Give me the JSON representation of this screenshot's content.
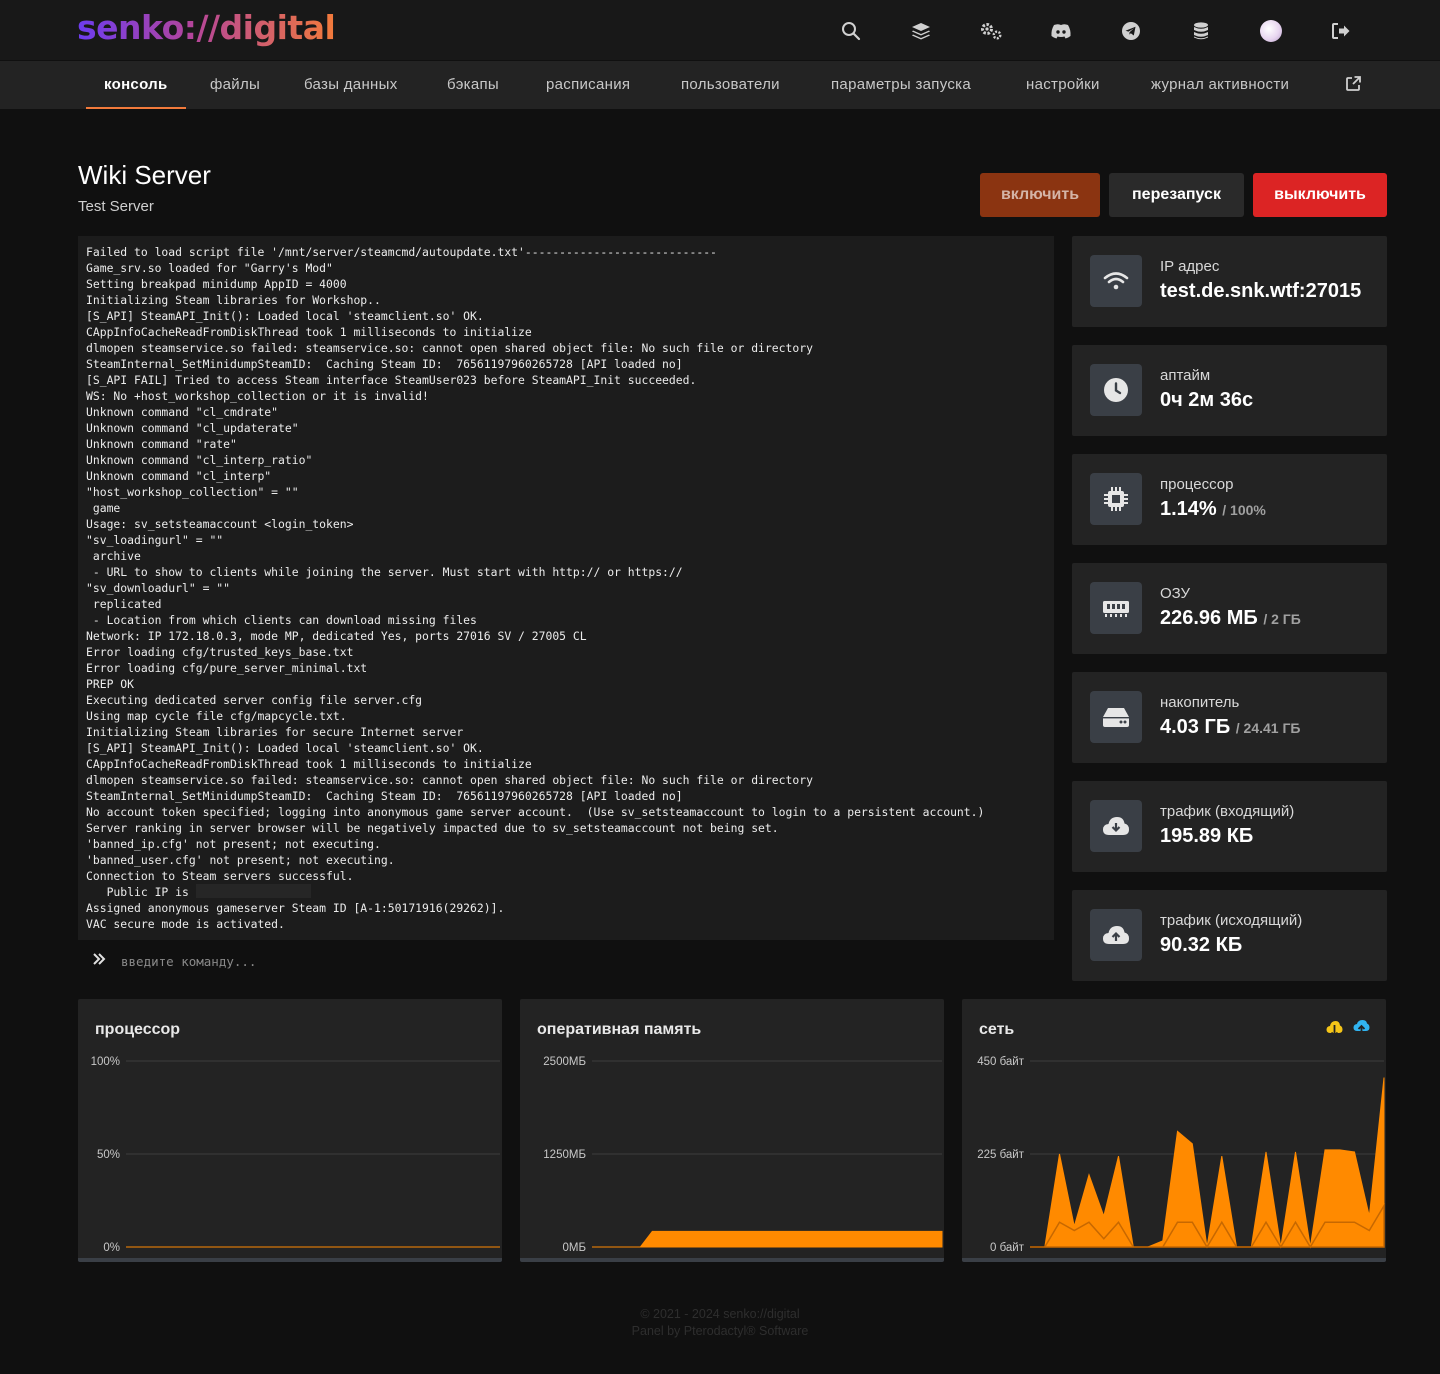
{
  "brand": {
    "logo": "senko://digital"
  },
  "header_icons": [
    "search-icon",
    "layers-icon",
    "cogs-icon",
    "discord-icon",
    "telegram-icon",
    "database-icon",
    "avatar",
    "logout-icon"
  ],
  "tabs": [
    {
      "label": "консоль",
      "active": true
    },
    {
      "label": "файлы"
    },
    {
      "label": "базы данных"
    },
    {
      "label": "бэкапы"
    },
    {
      "label": "расписания"
    },
    {
      "label": "пользователи"
    },
    {
      "label": "параметры запуска"
    },
    {
      "label": "настройки"
    },
    {
      "label": "журнал активности"
    }
  ],
  "server": {
    "name": "Wiki Server",
    "description": "Test Server"
  },
  "power": {
    "start": "включить",
    "restart": "перезапуск",
    "stop": "выключить"
  },
  "console": {
    "lines": [
      "Failed to load script file '/mnt/server/steamcmd/autoupdate.txt'----------------------------",
      "Game_srv.so loaded for \"Garry's Mod\"",
      "Setting breakpad minidump AppID = 4000",
      "Initializing Steam libraries for Workshop..",
      "[S_API] SteamAPI_Init(): Loaded local 'steamclient.so' OK.",
      "CAppInfoCacheReadFromDiskThread took 1 milliseconds to initialize",
      "dlmopen steamservice.so failed: steamservice.so: cannot open shared object file: No such file or directory",
      "SteamInternal_SetMinidumpSteamID:  Caching Steam ID:  76561197960265728 [API loaded no]",
      "[S_API FAIL] Tried to access Steam interface SteamUser023 before SteamAPI_Init succeeded.",
      "WS: No +host_workshop_collection or it is invalid!",
      "Unknown command \"cl_cmdrate\"",
      "Unknown command \"cl_updaterate\"",
      "Unknown command \"rate\"",
      "Unknown command \"cl_interp_ratio\"",
      "Unknown command \"cl_interp\"",
      "\"host_workshop_collection\" = \"\"",
      " game",
      "Usage: sv_setsteamaccount <login_token>",
      "\"sv_loadingurl\" = \"\"",
      " archive",
      " - URL to show to clients while joining the server. Must start with http:// or https://",
      "\"sv_downloadurl\" = \"\"",
      " replicated",
      " - Location from which clients can download missing files",
      "Network: IP 172.18.0.3, mode MP, dedicated Yes, ports 27016 SV / 27005 CL",
      "Error loading cfg/trusted_keys_base.txt",
      "Error loading cfg/pure_server_minimal.txt",
      "PREP OK",
      "Executing dedicated server config file server.cfg",
      "Using map cycle file cfg/mapcycle.txt.",
      "Initializing Steam libraries for secure Internet server",
      "[S_API] SteamAPI_Init(): Loaded local 'steamclient.so' OK.",
      "CAppInfoCacheReadFromDiskThread took 1 milliseconds to initialize",
      "dlmopen steamservice.so failed: steamservice.so: cannot open shared object file: No such file or directory",
      "SteamInternal_SetMinidumpSteamID:  Caching Steam ID:  76561197960265728 [API loaded no]",
      "No account token specified; logging into anonymous game server account.  (Use sv_setsteamaccount to login to a persistent account.)",
      "Server ranking in server browser will be negatively impacted due to sv_setsteamaccount not being set.",
      "'banned_ip.cfg' not present; not executing.",
      "'banned_user.cfg' not present; not executing.",
      "Connection to Steam servers successful.",
      "   Public IP is ",
      "Assigned anonymous gameserver Steam ID [A-1:50171916(29262)].",
      "VAC secure mode is activated."
    ],
    "masked_line_index": 40,
    "input_placeholder": "введите команду..."
  },
  "stats": [
    {
      "icon": "wifi-icon",
      "label": "IP адрес",
      "value": "test.de.snk.wtf:27015",
      "max": ""
    },
    {
      "icon": "clock-icon",
      "label": "аптайм",
      "value": "0ч 2м 36с",
      "max": ""
    },
    {
      "icon": "cpu-icon",
      "label": "процессор",
      "value": "1.14%",
      "max": "/ 100%"
    },
    {
      "icon": "memory-icon",
      "label": "ОЗУ",
      "value": "226.96 МБ",
      "max": "/ 2 ГБ"
    },
    {
      "icon": "hdd-icon",
      "label": "накопитель",
      "value": "4.03 ГБ",
      "max": "/ 24.41 ГБ"
    },
    {
      "icon": "cloud-download-icon",
      "label": "трафик (входящий)",
      "value": "195.89 КБ",
      "max": ""
    },
    {
      "icon": "cloud-upload-icon",
      "label": "трафик (исходящий)",
      "value": "90.32 КБ",
      "max": ""
    }
  ],
  "charts_meta": {
    "accent": "#ff8a00",
    "legend_in": "#f5c518",
    "legend_out": "#31b4f0"
  },
  "chart_data": [
    {
      "type": "area",
      "title": "процессор",
      "yticks": [
        "100%",
        "50%",
        "0%"
      ],
      "ylim": [
        0,
        100
      ],
      "values": [
        0,
        0,
        0,
        0,
        0,
        0,
        0,
        0,
        0,
        0,
        0,
        0,
        0,
        0,
        0,
        0,
        0,
        0,
        0,
        0,
        0,
        0,
        0,
        0,
        0,
        0,
        0,
        0,
        0,
        0
      ]
    },
    {
      "type": "area",
      "title": "оперативная память",
      "yticks": [
        "2500МБ",
        "1250МБ",
        "0МБ"
      ],
      "ylim": [
        0,
        2500
      ],
      "values": [
        0,
        0,
        0,
        0,
        0,
        210,
        210,
        210,
        210,
        210,
        210,
        210,
        210,
        210,
        210,
        210,
        210,
        210,
        210,
        210,
        210,
        210,
        210,
        210,
        210,
        210,
        210,
        210,
        210,
        210
      ]
    },
    {
      "type": "area",
      "title": "сеть",
      "yticks": [
        "450 байт",
        "225 байт",
        "0 байт"
      ],
      "ylim": [
        0,
        450
      ],
      "series": [
        {
          "values": [
            0,
            0,
            225,
            50,
            175,
            75,
            220,
            0,
            0,
            15,
            280,
            250,
            0,
            220,
            0,
            0,
            230,
            0,
            230,
            0,
            235,
            235,
            230,
            75,
            410
          ]
        },
        {
          "values": [
            0,
            0,
            60,
            40,
            60,
            20,
            60,
            0,
            0,
            0,
            60,
            60,
            0,
            60,
            0,
            0,
            60,
            0,
            60,
            0,
            60,
            60,
            60,
            40,
            100
          ]
        }
      ]
    }
  ],
  "footer": {
    "line1": "© 2021 - 2024 senko://digital",
    "line2": "Panel by Pterodactyl® Software"
  }
}
